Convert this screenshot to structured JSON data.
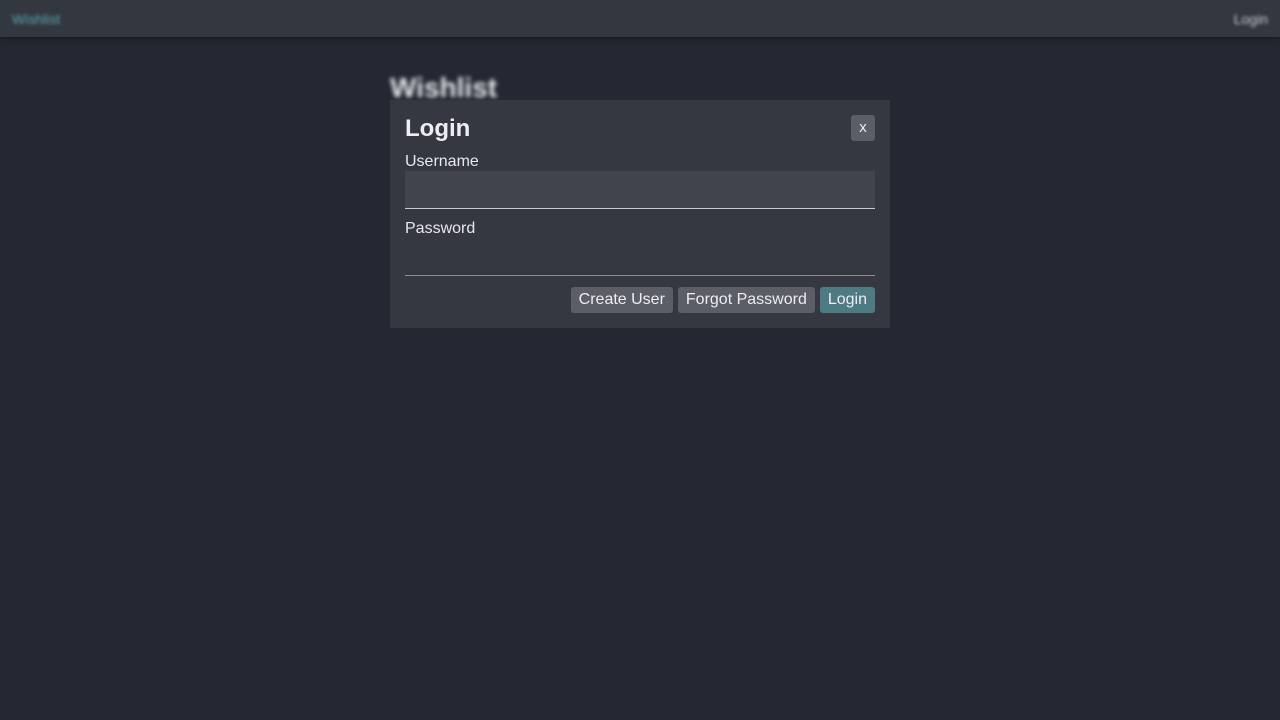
{
  "topbar": {
    "brand": "Wishlist",
    "login_link": "Login"
  },
  "page": {
    "heading": "Wishlist"
  },
  "login_modal": {
    "title": "Login",
    "close_label": "x",
    "username_label": "Username",
    "username_value": "",
    "password_label": "Password",
    "password_value": "",
    "buttons": {
      "create_user": "Create User",
      "forgot_password": "Forgot Password",
      "login": "Login"
    }
  },
  "colors": {
    "background": "#232832",
    "topbar": "#333740",
    "modal": "#353841",
    "accent": "#4e7a83",
    "secondary_button": "#5b5e66",
    "brand_link": "#5aa6b3"
  }
}
